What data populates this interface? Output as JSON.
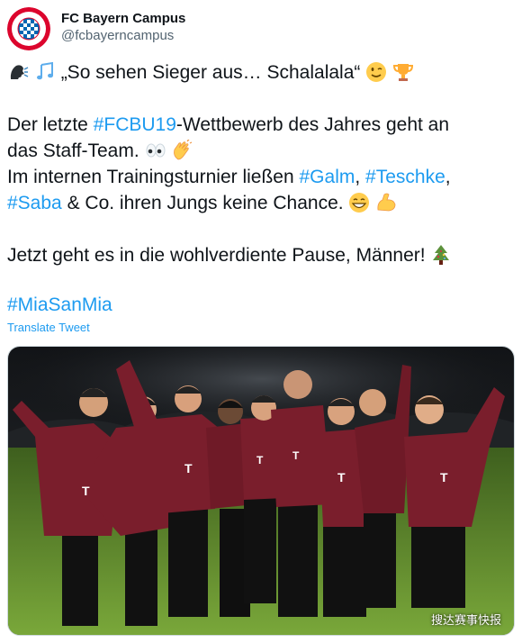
{
  "account": {
    "display_name": "FC Bayern Campus",
    "handle": "@fcbayerncampus",
    "avatar_icon": "fc-bayern-crest",
    "crest_text_top": "FC BAYERN",
    "crest_text_bottom": "MÜNCHEN"
  },
  "tweet": {
    "line1": "„So sehen Sieger aus… Schalalala“",
    "line2_before": "Der letzte ",
    "line2_tag": "#FCBU19",
    "line2_after": "-Wettbewerb des Jahres geht an",
    "line3": "das Staff-Team.",
    "line4_before": "Im internen Trainingsturnier ließen ",
    "line4_tag1": "#Galm",
    "line4_sep": ", ",
    "line4_tag2": "#Teschke",
    "line4_comma": ",",
    "line5_tag": "#Saba",
    "line5_after": " & Co. ihren Jungs keine Chance.",
    "line6": "Jetzt geht es in die wohlverdiente Pause, Männer!",
    "hashtag": "#MiaSanMia",
    "translate_label": "Translate Tweet"
  },
  "emojis": [
    "speaking-head-icon",
    "music-notes-icon",
    "winking-face-icon",
    "trophy-icon",
    "eyes-icon",
    "clapping-hands-icon",
    "grinning-face-icon",
    "flexed-biceps-icon",
    "christmas-tree-icon"
  ],
  "media": {
    "watermark": "搜达赛事快报",
    "description_colors": {
      "kit": "#7a1e2c",
      "grass": "#5f8d2c",
      "sky": "#1b1d21"
    }
  },
  "colors": {
    "link": "#1d9bf0",
    "text": "#0f1419",
    "secondary": "#536471",
    "brand_red": "#dc052d"
  }
}
